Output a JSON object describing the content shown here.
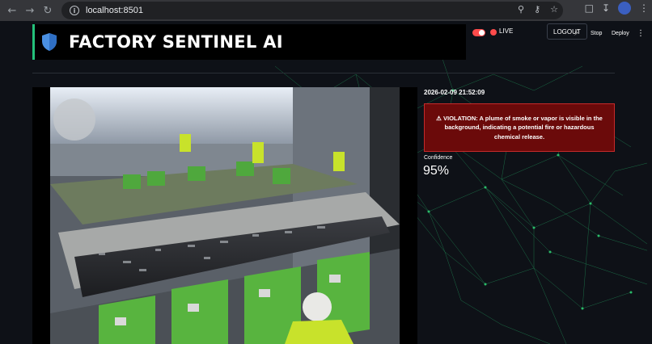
{
  "browser": {
    "url": "localhost:8501",
    "icons": [
      "back-icon",
      "forward-icon",
      "reload-icon",
      "zoom-icon",
      "key-icon",
      "star-icon",
      "extensions-icon",
      "download-icon",
      "menu-icon"
    ]
  },
  "header": {
    "title": "FACTORY SENTINEL AI",
    "accent_color": "#24c17a"
  },
  "toolbar": {
    "live_label": "LIVE",
    "logout_label": "LOGOUT",
    "stop_label": "Stop",
    "deploy_label": "Deploy"
  },
  "detection": {
    "timestamp": "2026-02-09 21:52:09",
    "alert_text": "⚠ VIOLATION: A plume of smoke or vapor is visible in the background, indicating a potential fire or hazardous chemical release.",
    "confidence_label": "Confidence",
    "confidence_value": "95%",
    "alert_color": "#6b0a0a"
  }
}
